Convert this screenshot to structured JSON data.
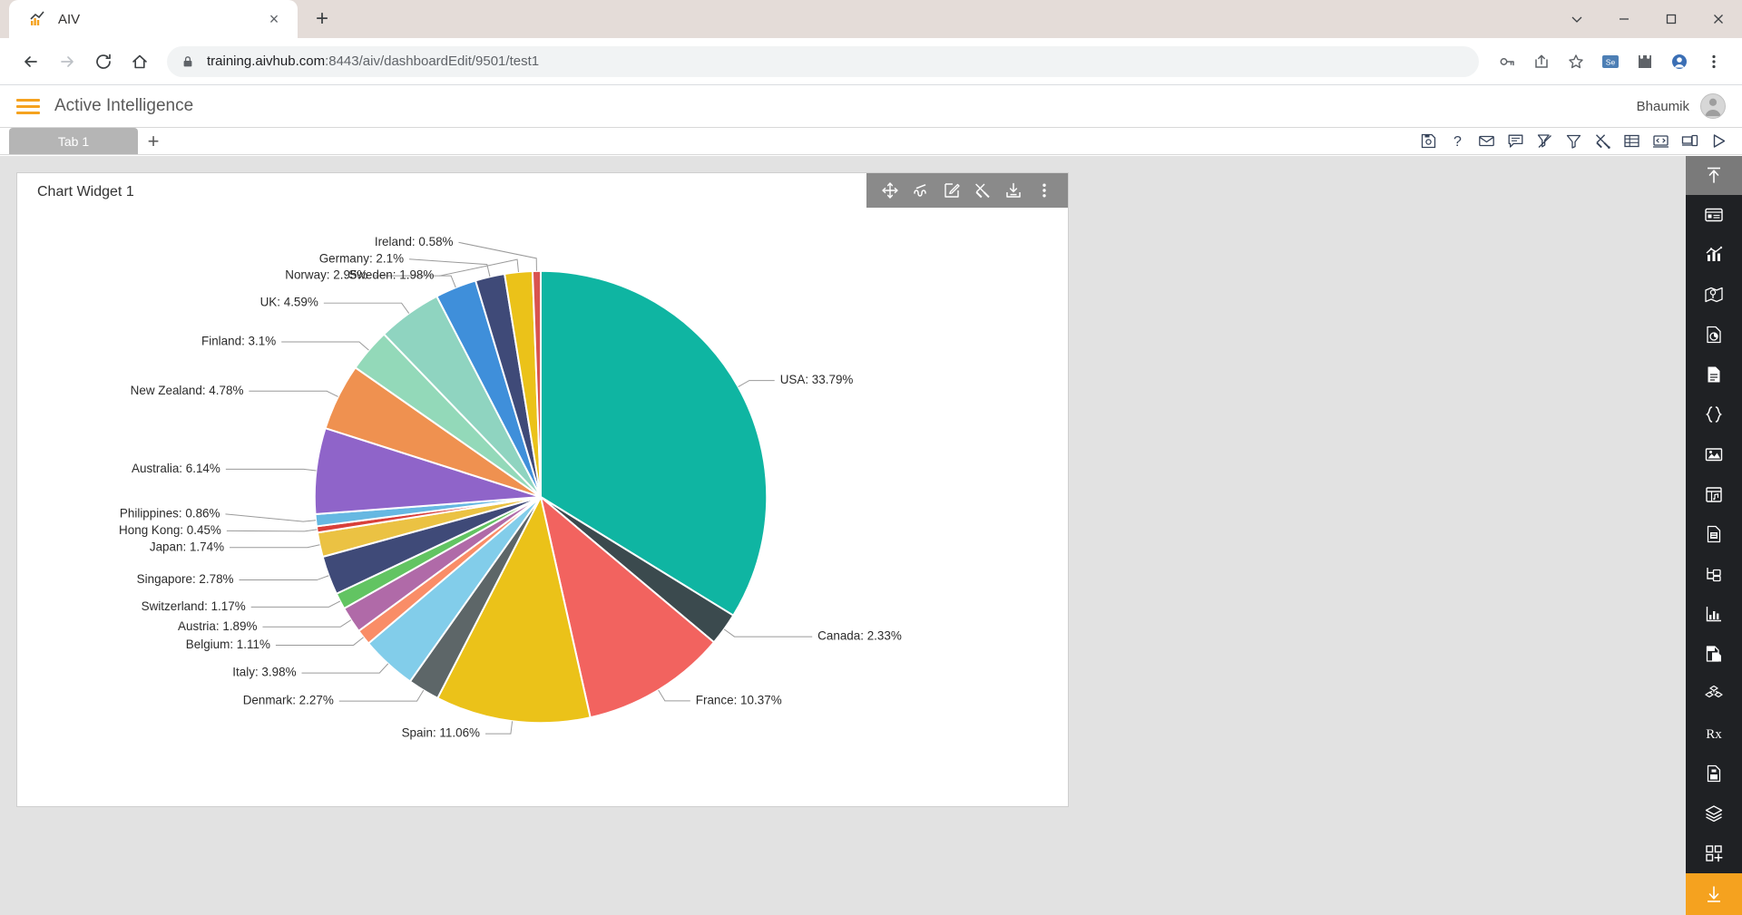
{
  "browser": {
    "tab": {
      "title": "AIV",
      "favicon": "chart-favicon",
      "close": "×",
      "new_tab": "+"
    },
    "window_controls": {
      "minimize_alt": "⌄",
      "minimize": "─",
      "maximize": "□",
      "close": "✕"
    },
    "toolbar": {
      "back": "back-icon",
      "forward": "forward-icon",
      "reload": "reload-icon",
      "home": "home-icon",
      "url_secure": "training.aivhub.com",
      "url_rest": ":8443/aiv/dashboardEdit/9501/test1",
      "url_full": "training.aivhub.com:8443/aiv/dashboardEdit/9501/test1",
      "icons": [
        "key-icon",
        "share-icon",
        "bookmark-star-icon",
        "selenium-icon",
        "extensions-icon",
        "profile-icon",
        "menu-dots-icon"
      ]
    }
  },
  "app": {
    "header": {
      "menu": "hamburger-icon",
      "title": "Active Intelligence",
      "user": "Bhaumik",
      "avatar": "user-avatar"
    },
    "tabbar": {
      "tabs": [
        {
          "label": "Tab 1"
        }
      ],
      "add_label": "+",
      "tools": [
        {
          "name": "save-icon",
          "title": "Save"
        },
        {
          "name": "help-icon",
          "title": "Help"
        },
        {
          "name": "mail-icon",
          "title": "Mail"
        },
        {
          "name": "comment-icon",
          "title": "Comment"
        },
        {
          "name": "clear-filter-icon",
          "title": "Clear Filter"
        },
        {
          "name": "filter-icon",
          "title": "Filter"
        },
        {
          "name": "tools-icon",
          "title": "Tools"
        },
        {
          "name": "table-icon",
          "title": "Table"
        },
        {
          "name": "code-icon",
          "title": "Code"
        },
        {
          "name": "device-icon",
          "title": "Device Preview"
        },
        {
          "name": "play-icon",
          "title": "Run"
        }
      ]
    },
    "widget": {
      "title": "Chart Widget 1",
      "toolbar": [
        {
          "name": "move-icon",
          "title": "Move"
        },
        {
          "name": "link-icon",
          "title": "Link"
        },
        {
          "name": "edit-icon",
          "title": "Edit"
        },
        {
          "name": "tools-icon",
          "title": "Tools"
        },
        {
          "name": "download-icon",
          "title": "Download"
        },
        {
          "name": "more-options-icon",
          "title": "More"
        }
      ]
    },
    "rail": {
      "top": {
        "name": "collapse-up-icon"
      },
      "items": [
        {
          "name": "card-widget-icon"
        },
        {
          "name": "chart-widget-icon"
        },
        {
          "name": "map-widget-icon"
        },
        {
          "name": "report-pie-icon"
        },
        {
          "name": "document-icon"
        },
        {
          "name": "code-braces-icon"
        },
        {
          "name": "image-widget-icon"
        },
        {
          "name": "calendar-widget-icon"
        },
        {
          "name": "form-document-icon"
        },
        {
          "name": "tree-hierarchy-icon"
        },
        {
          "name": "sparkline-icon"
        },
        {
          "name": "copy-page-icon"
        },
        {
          "name": "cubes-icon"
        },
        {
          "name": "prescription-icon"
        },
        {
          "name": "save-document-icon"
        },
        {
          "name": "layers-icon"
        },
        {
          "name": "add-widget-icon"
        }
      ],
      "bottom": {
        "name": "download-arrow-icon"
      }
    }
  },
  "chart_data": {
    "type": "pie",
    "title": "",
    "legend_position": "none",
    "label_format": "{name}: {value}%",
    "categories": [
      "USA",
      "Canada",
      "France",
      "Spain",
      "Denmark",
      "Italy",
      "Belgium",
      "Austria",
      "Switzerland",
      "Singapore",
      "Japan",
      "Hong Kong",
      "Philippines",
      "Australia",
      "New Zealand",
      "Finland",
      "UK",
      "Norway",
      "Germany",
      "Sweden",
      "Ireland"
    ],
    "values": [
      33.79,
      2.33,
      10.37,
      11.06,
      2.27,
      3.98,
      1.11,
      1.89,
      1.17,
      2.78,
      1.74,
      0.45,
      0.86,
      6.14,
      4.78,
      3.1,
      4.59,
      2.95,
      2.1,
      1.98,
      0.58
    ],
    "colors": [
      "#0fb5a2",
      "#3b4a4e",
      "#f2635f",
      "#ebc219",
      "#5d6668",
      "#82cdea",
      "#f98d67",
      "#b06aa8",
      "#62c462",
      "#3f4a78",
      "#ebc243",
      "#d9403a",
      "#66b8e2",
      "#8f64c9",
      "#ef9150",
      "#93d9b9",
      "#8fd4c0",
      "#3f8fda",
      "#3f4a78",
      "#ebc219",
      "#d9534f"
    ],
    "slices": [
      {
        "label": "USA: 33.79%",
        "name": "USA",
        "value": 33.79,
        "color": "#0fb5a2"
      },
      {
        "label": "Canada: 2.33%",
        "name": "Canada",
        "value": 2.33,
        "color": "#3b4a4e"
      },
      {
        "label": "France: 10.37%",
        "name": "France",
        "value": 10.37,
        "color": "#f2635f"
      },
      {
        "label": "Spain: 11.06%",
        "name": "Spain",
        "value": 11.06,
        "color": "#ebc219"
      },
      {
        "label": "Denmark: 2.27%",
        "name": "Denmark",
        "value": 2.27,
        "color": "#5d6668"
      },
      {
        "label": "Italy: 3.98%",
        "name": "Italy",
        "value": 3.98,
        "color": "#82cdea"
      },
      {
        "label": "Belgium: 1.11%",
        "name": "Belgium",
        "value": 1.11,
        "color": "#f98d67"
      },
      {
        "label": "Austria: 1.89%",
        "name": "Austria",
        "value": 1.89,
        "color": "#b06aa8"
      },
      {
        "label": "Switzerland: 1.17%",
        "name": "Switzerland",
        "value": 1.17,
        "color": "#62c462"
      },
      {
        "label": "Singapore: 2.78%",
        "name": "Singapore",
        "value": 2.78,
        "color": "#3f4a78"
      },
      {
        "label": "Japan: 1.74%",
        "name": "Japan",
        "value": 1.74,
        "color": "#ebc243"
      },
      {
        "label": "Hong Kong: 0.45%",
        "name": "Hong Kong",
        "value": 0.45,
        "color": "#d9403a"
      },
      {
        "label": "Philippines: 0.86%",
        "name": "Philippines",
        "value": 0.86,
        "color": "#66b8e2"
      },
      {
        "label": "Australia: 6.14%",
        "name": "Australia",
        "value": 6.14,
        "color": "#8f64c9"
      },
      {
        "label": "New Zealand: 4.78%",
        "name": "New Zealand",
        "value": 4.78,
        "color": "#ef9150"
      },
      {
        "label": "Finland: 3.1%",
        "name": "Finland",
        "value": 3.1,
        "color": "#93d9b9"
      },
      {
        "label": "UK: 4.59%",
        "name": "UK",
        "value": 4.59,
        "color": "#8fd4c0"
      },
      {
        "label": "Norway: 2.95%",
        "name": "Norway",
        "value": 2.95,
        "color": "#3f8fda"
      },
      {
        "label": "Germany: 2.1%",
        "name": "Germany",
        "value": 2.1,
        "color": "#3f4a78"
      },
      {
        "label": "Sweden: 1.98%",
        "name": "Sweden",
        "value": 1.98,
        "color": "#ebc219"
      },
      {
        "label": "Ireland: 0.58%",
        "name": "Ireland",
        "value": 0.58,
        "color": "#d9534f"
      }
    ]
  }
}
